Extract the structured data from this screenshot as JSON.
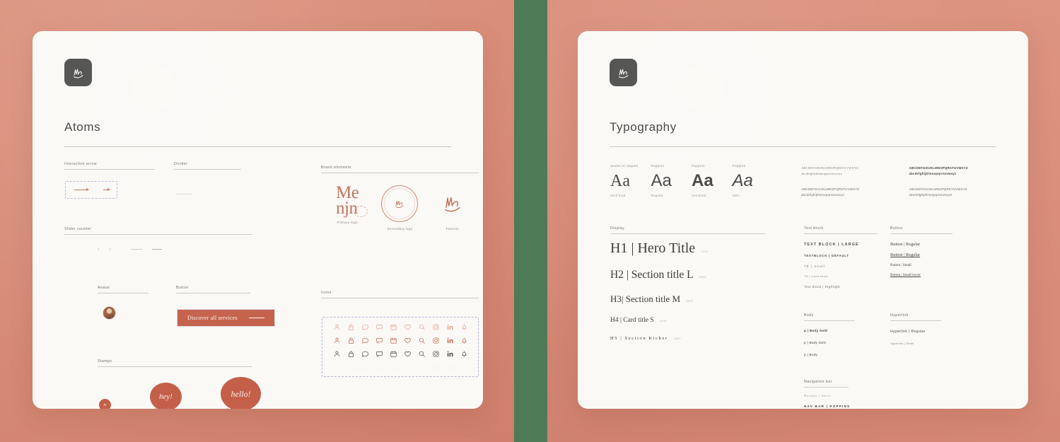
{
  "theme": {
    "bg_salmon": "#d78a76",
    "divider_green": "#4e7a55",
    "card_bg": "#fbf9f6",
    "terracotta": "#c4604a",
    "ink": "#3c3c3a"
  },
  "left_sheet": {
    "logo_alt": "menjn-monogram",
    "title": "Atoms",
    "sections": {
      "interactive_arrow": "Interactive arrow",
      "divider": "Divider",
      "slider_counter": "Slider counter",
      "avatar": "Avatar",
      "button": "Button",
      "stamps": "Stamps",
      "brand_elements": "Brand elements",
      "icons": "Icons"
    },
    "button": {
      "label": "Discover all services"
    },
    "slider_counter": {
      "current": "1",
      "total": "4"
    },
    "brand": {
      "primary_logo_line1": "Me",
      "primary_logo_line2": "njn",
      "captions": [
        "Primary logo",
        "Secondary logo",
        "Favicon"
      ]
    },
    "stamps": {
      "dot": "m",
      "bubble_small": "hey!",
      "bubble_large": "hello!"
    },
    "icons": {
      "names": [
        "user-icon",
        "lock-icon",
        "chat-bubble-icon",
        "message-icon",
        "calendar-icon",
        "heart-icon",
        "search-icon",
        "instagram-icon",
        "linkedin-icon",
        "bell-icon"
      ],
      "row_colors": [
        "#e3a18f",
        "#c4604a",
        "#4a4a48",
        "#ece2da"
      ]
    }
  },
  "right_sheet": {
    "logo_alt": "menjn-monogram",
    "title": "Typography",
    "specimens": [
      {
        "family": "Jaules et Jaques",
        "sample": "Aa",
        "weight": "Serif bold"
      },
      {
        "family": "Poppins",
        "sample": "Aa",
        "weight": "Regular"
      },
      {
        "family": "Poppins",
        "sample": "Aa",
        "weight": "Semibold"
      },
      {
        "family": "Poppins",
        "sample": "Aa",
        "weight": "Italic"
      }
    ],
    "charsets": [
      {
        "upper": "ABCDEFGHIJKLMNOPQRSTUVWXYZ",
        "lower": "abcdefghijklmnopqrstuvwxyz",
        "style": "serif"
      },
      {
        "upper": "ABCDEFGHIJKLMNOPQRSTUVWXYZ",
        "lower": "abcdefghijklmnopqrstuvwxyz",
        "style": "bold"
      },
      {
        "upper": "ABCDEFGHIJKLMNOPQRSTUVWXYZ",
        "lower": "abcdefghijklmnopqrstuvwxyz",
        "style": "regular"
      },
      {
        "upper": "ABCDEFGHIJKLMNOPQRSTUVWXYZ",
        "lower": "abcdefghijklmnopqrstuvwxyz",
        "style": "italic"
      }
    ],
    "display": {
      "label": "Display",
      "items": [
        {
          "text": "H1 | Hero Title",
          "size": "72/80"
        },
        {
          "text": "H2 | Section title L",
          "size": "56/64"
        },
        {
          "text": "H3| Section title M",
          "size": "44/52"
        },
        {
          "text": "H4 | Card title S",
          "size": "32/40"
        },
        {
          "text": "H5 | Section Kicker",
          "size": "24/32"
        }
      ]
    },
    "text_block": {
      "label": "Text block",
      "items": [
        "TEXT BLOCK | LARGE",
        "TEXTBLOCK | DEFAULT",
        "TB | Small",
        "TB | extra small",
        "Text block | Highlight"
      ]
    },
    "buttons": {
      "label": "Button",
      "items": [
        "Button | Regular",
        "Button | Regular",
        "Button | Small",
        "Button | Small hover"
      ]
    },
    "body": {
      "label": "Body",
      "items": [
        "p | Body bold",
        "p | Body italic",
        "p | Body"
      ]
    },
    "hyperlink": {
      "label": "Hyperlink",
      "items": [
        "Hyperlink | Regular",
        "Hyperlink | Small"
      ]
    },
    "navigation": {
      "label": "Navigation bar",
      "items": [
        "Navbar | Serif",
        "NAV BAR | POPPINS"
      ]
    }
  }
}
